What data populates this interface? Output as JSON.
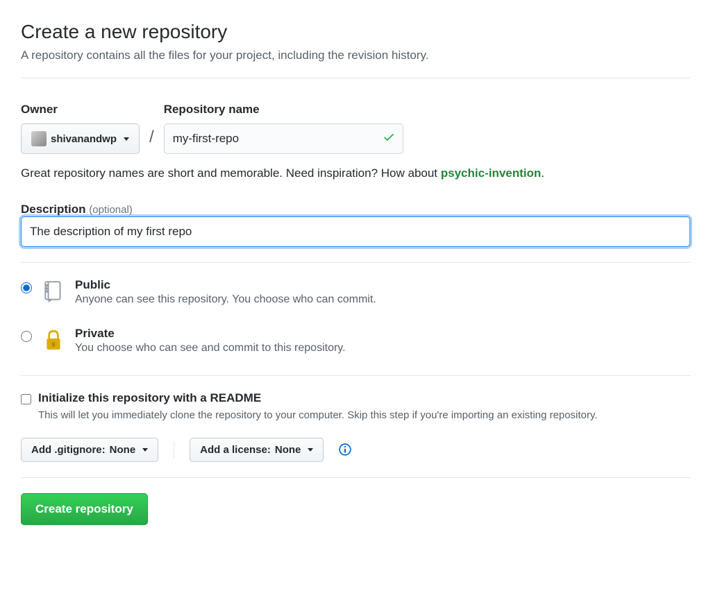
{
  "header": {
    "title": "Create a new repository",
    "subtitle": "A repository contains all the files for your project, including the revision history."
  },
  "form": {
    "owner_label": "Owner",
    "owner_name": "shivanandwp",
    "repo_label": "Repository name",
    "repo_name": "my-first-repo",
    "hint": {
      "prefix": "Great repository names are short and memorable. Need inspiration? How about ",
      "suggestion": "psychic-invention",
      "suffix": "."
    },
    "description_label": "Description",
    "description_optional": "(optional)",
    "description_value": "The description of my first repo"
  },
  "visibility": {
    "public": {
      "title": "Public",
      "desc": "Anyone can see this repository. You choose who can commit."
    },
    "private": {
      "title": "Private",
      "desc": "You choose who can see and commit to this repository."
    }
  },
  "init": {
    "readme_title": "Initialize this repository with a README",
    "readme_desc": "This will let you immediately clone the repository to your computer. Skip this step if you're importing an existing repository.",
    "gitignore_label": "Add .gitignore:",
    "gitignore_value": "None",
    "license_label": "Add a license:",
    "license_value": "None"
  },
  "submit": {
    "button": "Create repository"
  }
}
